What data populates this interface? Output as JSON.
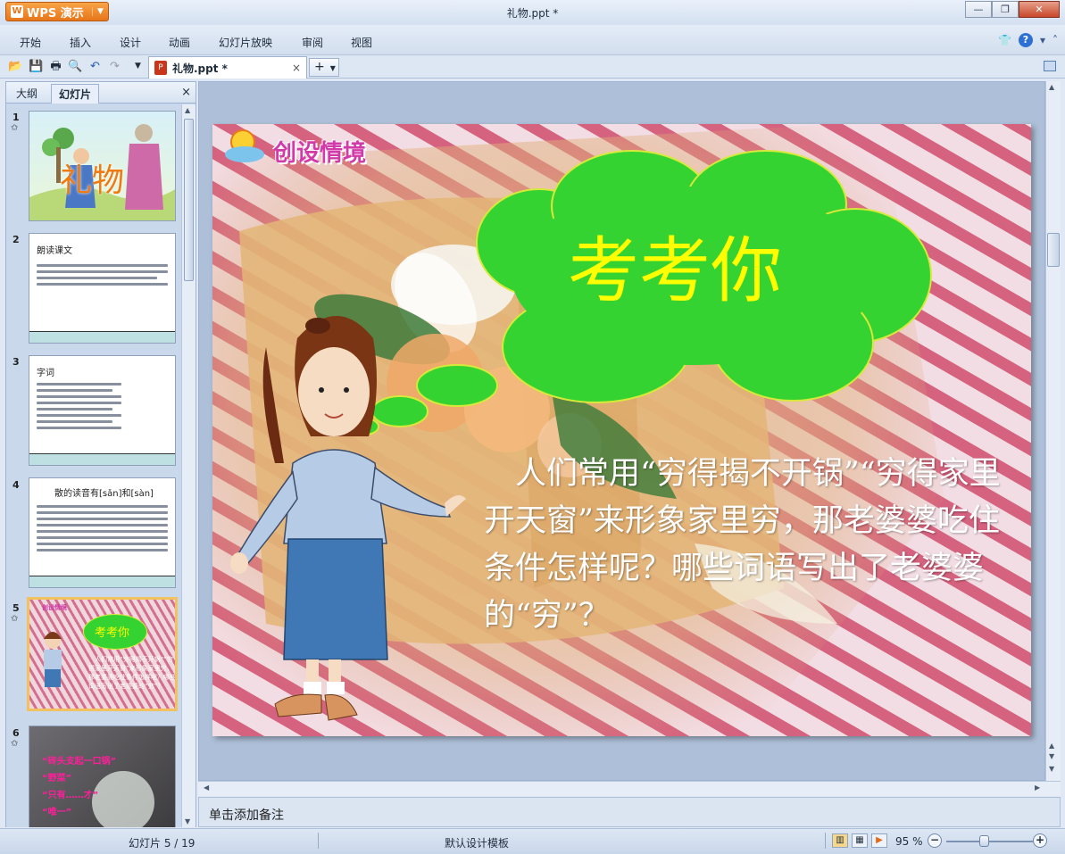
{
  "app": {
    "name": "WPS 演示",
    "doc_title": "礼物.ppt *",
    "colors": {
      "titlebar": "#dce6f4",
      "app_button": "#e9831f",
      "slide_bg": "#d88f9f",
      "cloud_fill": "#35d331",
      "cloud_text": "#ffff00"
    }
  },
  "menu": {
    "items": [
      "开始",
      "插入",
      "设计",
      "动画",
      "幻灯片放映",
      "审阅",
      "视图"
    ]
  },
  "toolbar": {
    "icons": [
      "open-icon",
      "save-icon",
      "print-icon",
      "print-preview-icon",
      "undo-icon",
      "redo-icon"
    ],
    "tab_label": "礼物.ppt *",
    "tab_close": "×",
    "new_tab": "+"
  },
  "panel": {
    "tabs": [
      "大纲",
      "幻灯片"
    ],
    "close": "×",
    "thumbnails": [
      {
        "num": "1",
        "star": "✩",
        "title": "礼物"
      },
      {
        "num": "2",
        "star": "",
        "title": "朗读课文"
      },
      {
        "num": "3",
        "star": "",
        "title": "字词"
      },
      {
        "num": "4",
        "star": "",
        "title": "散的读音有[sǎn]和[sàn]"
      },
      {
        "num": "5",
        "star": "✩",
        "title": "考考你",
        "label": "创设情境"
      },
      {
        "num": "6",
        "star": "✩",
        "items": [
          "“砖头支起一口锅”",
          "“野菜”",
          "“只有……才”",
          "“唯一”"
        ]
      }
    ]
  },
  "slide": {
    "label": "创设情境",
    "cloud_text": "考考你",
    "body": "　人们常用“穷得揭不开锅”“穷得家里开天窗”来形象家里穷，那老婆婆吃住条件怎样呢？哪些词语写出了老婆婆的“穷”？"
  },
  "notes": {
    "placeholder": "单击添加备注"
  },
  "status": {
    "slide_counter": "幻灯片 5 / 19",
    "template": "默认设计模板",
    "zoom": "95 %",
    "zoom_level": 0.5
  }
}
